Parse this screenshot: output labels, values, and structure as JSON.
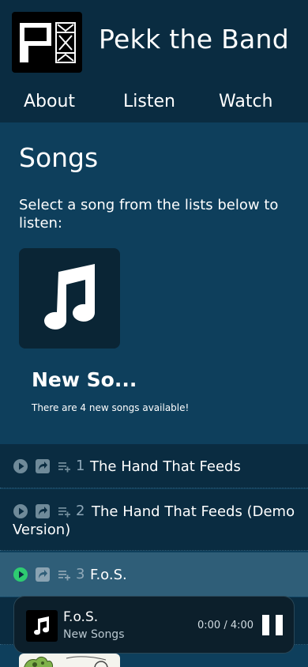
{
  "header": {
    "band_name": "Pekk the Band",
    "nav": [
      "About",
      "Listen",
      "Watch"
    ]
  },
  "page": {
    "title": "Songs",
    "intro": "Select a song from the lists below to listen:"
  },
  "album": {
    "title": "New So...",
    "description": "There are 4 new songs available!",
    "icon": "music-note-icon"
  },
  "songs": [
    {
      "number": "1",
      "title": "The Hand That Feeds",
      "active": false
    },
    {
      "number": "2",
      "title": "The Hand That Feeds (Demo Version)",
      "active": false
    },
    {
      "number": "3",
      "title": "F.o.S.",
      "active": true
    }
  ],
  "player": {
    "title": "F.o.S.",
    "album": "New Songs",
    "time": "0:00 / 4:00",
    "state": "playing",
    "icon": "pause-icon"
  },
  "colors": {
    "background": "#0e3f5c",
    "header": "#0a2c41",
    "active_row": "#2f5e78",
    "play_accent": "#2ecc71"
  }
}
